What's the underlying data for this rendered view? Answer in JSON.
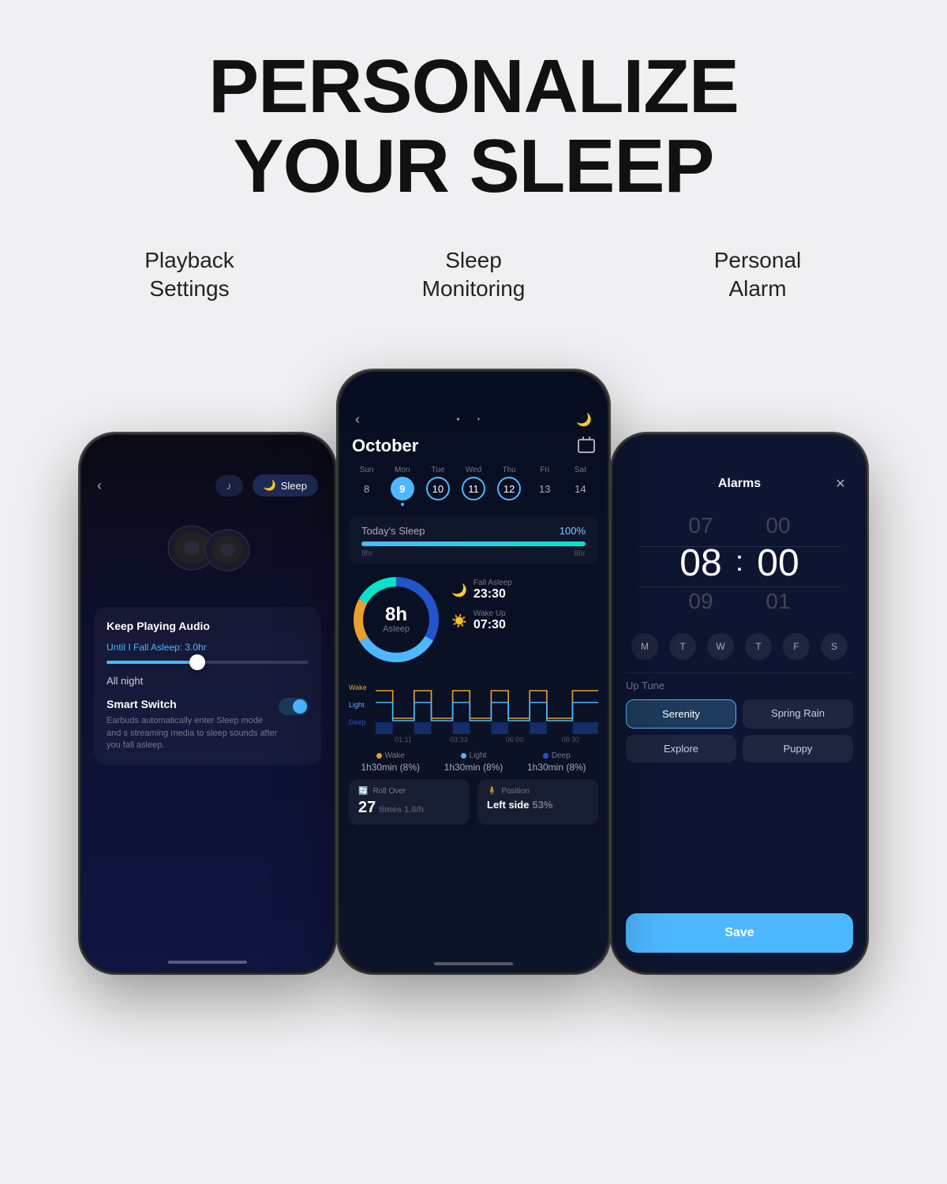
{
  "page": {
    "title_line1": "PERSONALIZE",
    "title_line2": "YOUR SLEEP"
  },
  "columns": {
    "left_label": "Playback\nSettings",
    "center_label": "Sleep\nMonitoring",
    "right_label": "Personal\nAlarm"
  },
  "left_phone": {
    "tab1": "♪",
    "tab2": "Sleep",
    "setting_title": "Keep Playing Audio",
    "until_label": "Until I Fall Asleep:",
    "until_value": "3.0hr",
    "all_night": "All night",
    "smart_switch_title": "Smart Switch",
    "smart_switch_desc": "Earbuds automatically enter Sleep mode and s streaming media to sleep sounds after you fall asleep."
  },
  "center_phone": {
    "month": "October",
    "days": [
      {
        "name": "Sun",
        "num": "8",
        "state": "normal"
      },
      {
        "name": "Mon",
        "num": "9",
        "state": "active"
      },
      {
        "name": "Tue",
        "num": "10",
        "state": "ring"
      },
      {
        "name": "Wed",
        "num": "11",
        "state": "ring"
      },
      {
        "name": "Thu",
        "num": "12",
        "state": "ring"
      },
      {
        "name": "Fri",
        "num": "13",
        "state": "normal"
      },
      {
        "name": "Sat",
        "num": "14",
        "state": "normal"
      }
    ],
    "today_sleep_label": "Today's Sleep",
    "today_sleep_pct": "100%",
    "progress_left": "8hr",
    "progress_right": "8hr",
    "sleep_hours": "8h",
    "sleep_label_text": "Asleep",
    "fall_asleep_label": "Fall Asleep",
    "fall_asleep_time": "23:30",
    "wake_up_label": "Wake Up",
    "wake_up_time": "07:30",
    "chart_y_labels": [
      "Wake",
      "Light",
      "Deep"
    ],
    "chart_x_labels": [
      "01:11",
      "03:33",
      "06:00",
      "08:30"
    ],
    "legend": [
      {
        "dot_color": "#e8a030",
        "name": "Wake",
        "value": "1h30min (8%)"
      },
      {
        "dot_color": "#4db8ff",
        "name": "Light",
        "value": "1h30min (8%)"
      },
      {
        "dot_color": "#2255cc",
        "name": "Deep",
        "value": "1h30min (8%)"
      }
    ],
    "roll_over_label": "Roll Over",
    "roll_over_value": "27",
    "roll_over_sub": "times 1.6/h",
    "position_label": "Position",
    "position_value": "Left side",
    "position_pct": "53%"
  },
  "right_phone": {
    "alarms_title": "Alarms",
    "time_hours_above": "07",
    "time_hours": "08",
    "time_hours_below": "09",
    "time_minutes_above": "00",
    "time_minutes": "00",
    "time_minutes_below": "01",
    "days": [
      "M",
      "T",
      "W",
      "T",
      "F",
      "S"
    ],
    "wake_tune_label": "Up Tune",
    "tunes": [
      {
        "name": "Serenity",
        "selected": true
      },
      {
        "name": "Spring Rain",
        "selected": false
      },
      {
        "name": "Explore",
        "selected": false
      },
      {
        "name": "Puppy",
        "selected": false
      }
    ],
    "save_label": "Save"
  },
  "colors": {
    "accent_blue": "#4db8ff",
    "bg_dark": "#0d1530",
    "wake_color": "#e8a030",
    "light_color": "#4db8ff",
    "deep_color": "#2255cc",
    "donut_green": "#00e5cc",
    "donut_orange": "#e8a030",
    "donut_blue": "#4db8ff",
    "donut_dark": "#1a2a50"
  }
}
